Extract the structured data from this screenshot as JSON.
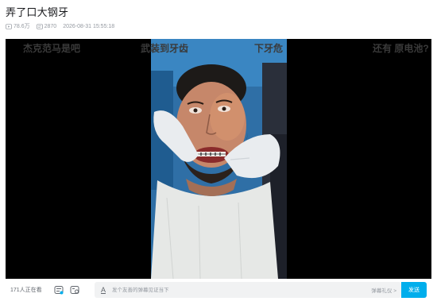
{
  "video": {
    "title": "弄了口大钢牙",
    "play_count": "78.6万",
    "danmaku_count": "2870",
    "publish_time": "2026-08-31 15:55:18"
  },
  "danmaku": [
    "杰克范马是吧",
    "武装到牙齿",
    "下牙危",
    "还有 原电池?"
  ],
  "controlbar": {
    "viewers": "171人正在看",
    "input_placeholder": "发个友善的弹幕见证当下",
    "etiquette": "弹幕礼仪 >",
    "send_label": "发送",
    "accent_color": "#00aeec"
  },
  "icons": {
    "play_count": "play-count-icon",
    "danmaku_count": "danmaku-count-icon",
    "danmaku_toggle": "danmaku-toggle-icon",
    "danmaku_settings": "danmaku-settings-icon",
    "danmaku_style": "font-style-icon"
  }
}
